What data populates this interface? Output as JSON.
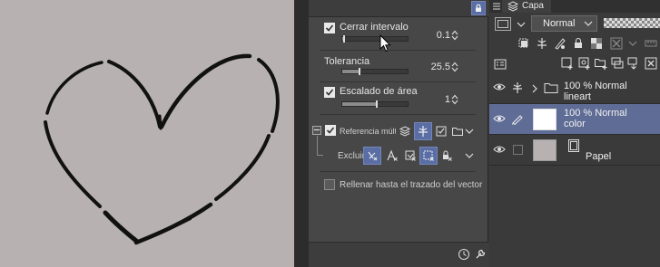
{
  "properties": {
    "close_gap": {
      "label": "Cerrar intervalo",
      "checked": true,
      "value": "0.1"
    },
    "tolerance": {
      "label": "Tolerancia",
      "value": "25.5"
    },
    "area_scaling": {
      "label": "Escalado de área",
      "checked": true,
      "value": "1"
    },
    "multi_ref": {
      "label": "Referencia múlt"
    },
    "exclude": {
      "label": "Excluir"
    },
    "fill_to_vector": {
      "label": "Rellenar hasta el trazado del vector",
      "checked": false
    }
  },
  "layer_panel": {
    "tab_label": "Capa",
    "blend_mode": "Normal",
    "layers": [
      {
        "opacity_mode": "100 % Normal",
        "name": "lineart",
        "type": "folder",
        "visible": true,
        "selected": false
      },
      {
        "opacity_mode": "100 % Normal",
        "name": "color",
        "type": "raster",
        "visible": true,
        "selected": true
      },
      {
        "opacity_mode": "",
        "name": "Papel",
        "type": "paper",
        "visible": true,
        "selected": false
      }
    ]
  },
  "colors": {
    "canvas_bg": "#b7b1b1",
    "panel_bg": "#474747",
    "selection_accent": "#5a6ea5",
    "selected_layer": "#5f6d96"
  }
}
